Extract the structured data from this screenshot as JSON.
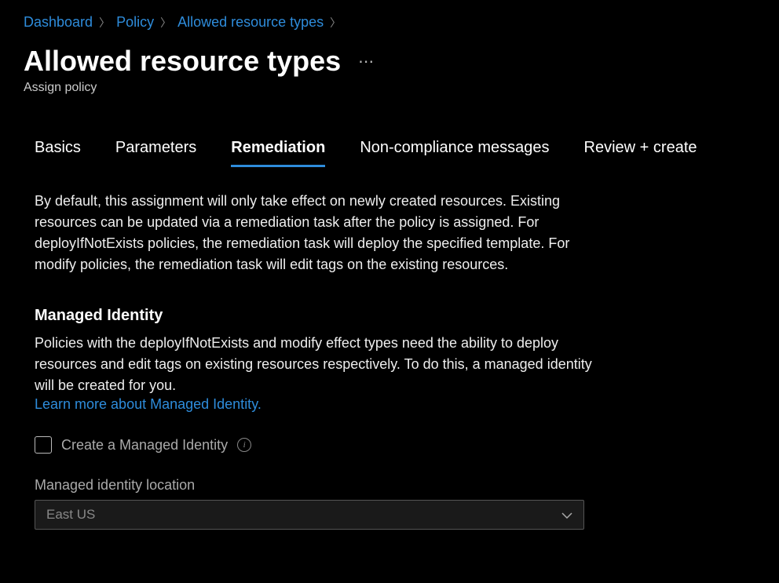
{
  "breadcrumb": {
    "items": [
      "Dashboard",
      "Policy",
      "Allowed resource types"
    ]
  },
  "header": {
    "title": "Allowed resource types",
    "subtitle": "Assign policy"
  },
  "tabs": {
    "items": [
      "Basics",
      "Parameters",
      "Remediation",
      "Non-compliance messages",
      "Review + create"
    ],
    "active_index": 2
  },
  "remediation": {
    "description": "By default, this assignment will only take effect on newly created resources. Existing resources can be updated via a remediation task after the policy is assigned. For deployIfNotExists policies, the remediation task will deploy the specified template. For modify policies, the remediation task will edit tags on the existing resources.",
    "managed_identity": {
      "heading": "Managed Identity",
      "text": "Policies with the deployIfNotExists and modify effect types need the ability to deploy resources and edit tags on existing resources respectively. To do this, a managed identity will be created for you.",
      "link_text": "Learn more about Managed Identity.",
      "checkbox_label": "Create a Managed Identity",
      "checkbox_checked": false,
      "location_label": "Managed identity location",
      "location_value": "East US"
    }
  }
}
